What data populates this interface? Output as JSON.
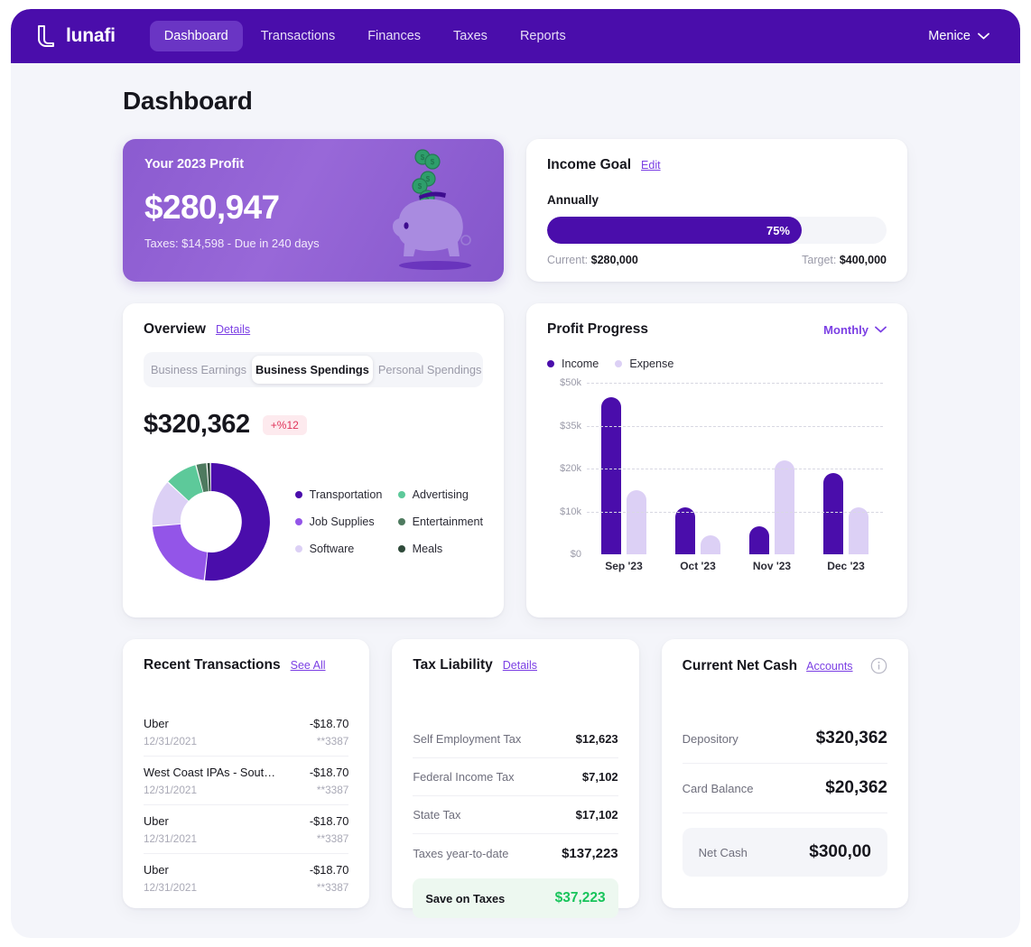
{
  "navbar": {
    "brand": "lunafi",
    "items": [
      {
        "label": "Dashboard",
        "active": true
      },
      {
        "label": "Transactions",
        "active": false
      },
      {
        "label": "Finances",
        "active": false
      },
      {
        "label": "Taxes",
        "active": false
      },
      {
        "label": "Reports",
        "active": false
      }
    ],
    "user": "Menice",
    "brand_bg": "#4A0DAB",
    "active_bg": "#6A35C4"
  },
  "page": {
    "title": "Dashboard"
  },
  "profit_card": {
    "label": "Your 2023 Profit",
    "value": "$280,947",
    "sub": "Taxes: $14,598 - Due in 240 days"
  },
  "income_goal": {
    "title": "Income Goal",
    "edit_label": "Edit",
    "period": "Annually",
    "percent_label": "75%",
    "percent": 75,
    "current_label": "Current:",
    "current_value": "$280,000",
    "target_label": "Target:",
    "target_value": "$400,000"
  },
  "overview": {
    "title": "Overview",
    "details_label": "Details",
    "tabs": [
      {
        "label": "Business Earnings",
        "active": false
      },
      {
        "label": "Business Spendings",
        "active": true
      },
      {
        "label": "Personal Spendings",
        "active": false
      }
    ],
    "amount": "$320,362",
    "change_badge": "+%12"
  },
  "profit_progress": {
    "title": "Profit Progress",
    "period_label": "Monthly",
    "legend": [
      {
        "label": "Income",
        "color": "#4A0DAB"
      },
      {
        "label": "Expense",
        "color": "#DCD0F5"
      }
    ]
  },
  "recent_transactions": {
    "title": "Recent Transactions",
    "see_all_label": "See All",
    "rows": [
      {
        "name": "Uber",
        "amount": "-$18.70",
        "date": "12/31/2021",
        "account": "**3387"
      },
      {
        "name": "West Coast IPAs - South...",
        "amount": "-$18.70",
        "date": "12/31/2021",
        "account": "**3387"
      },
      {
        "name": "Uber",
        "amount": "-$18.70",
        "date": "12/31/2021",
        "account": "**3387"
      },
      {
        "name": "Uber",
        "amount": "-$18.70",
        "date": "12/31/2021",
        "account": "**3387"
      }
    ]
  },
  "tax_liability": {
    "title": "Tax Liability",
    "details_label": "Details",
    "rows": [
      {
        "label": "Self Employment Tax",
        "value": "$12,623"
      },
      {
        "label": "Federal Income Tax",
        "value": "$7,102"
      },
      {
        "label": "State Tax",
        "value": "$17,102"
      },
      {
        "label": "Taxes year-to-date",
        "value": "$137,223"
      }
    ],
    "save_label": "Save on Taxes",
    "save_value": "$37,223",
    "save_color": "#18C45B"
  },
  "current_net_cash": {
    "title": "Current Net Cash",
    "accounts_label": "Accounts",
    "rows": [
      {
        "label": "Depository",
        "value": "$320,362"
      },
      {
        "label": "Card Balance",
        "value": "$20,362"
      }
    ],
    "net_label": "Net Cash",
    "net_value": "$300,00"
  },
  "chart_data": [
    {
      "type": "pie",
      "title": "Business Spendings by Category",
      "subtitle": "$320,362",
      "legend_position": "right",
      "categories": [
        "Transportation",
        "Job Supplies",
        "Software",
        "Advertising",
        "Entertainment",
        "Meals"
      ],
      "values": [
        52,
        22,
        13,
        9,
        3,
        1
      ],
      "colors": [
        "#4A0DAB",
        "#9355E8",
        "#DCD0F5",
        "#5DC99A",
        "#4E7A5F",
        "#2F4A3A"
      ],
      "donut": true
    },
    {
      "type": "bar",
      "title": "Profit Progress",
      "xlabel": "",
      "ylabel": "",
      "categories": [
        "Sep '23",
        "Oct '23",
        "Nov '23",
        "Dec '23"
      ],
      "ytick_labels": [
        "$0",
        "$10k",
        "$20k",
        "$35k",
        "$50k"
      ],
      "ytick_values": [
        0,
        10000,
        20000,
        35000,
        50000
      ],
      "ylim": [
        0,
        50000
      ],
      "grid": true,
      "legend_position": "top-left",
      "series": [
        {
          "name": "Income",
          "color": "#4A0DAB",
          "values": [
            45000,
            11000,
            6500,
            19000
          ]
        },
        {
          "name": "Expense",
          "color": "#DCD0F5",
          "values": [
            15000,
            4500,
            23000,
            11000
          ]
        }
      ]
    }
  ]
}
